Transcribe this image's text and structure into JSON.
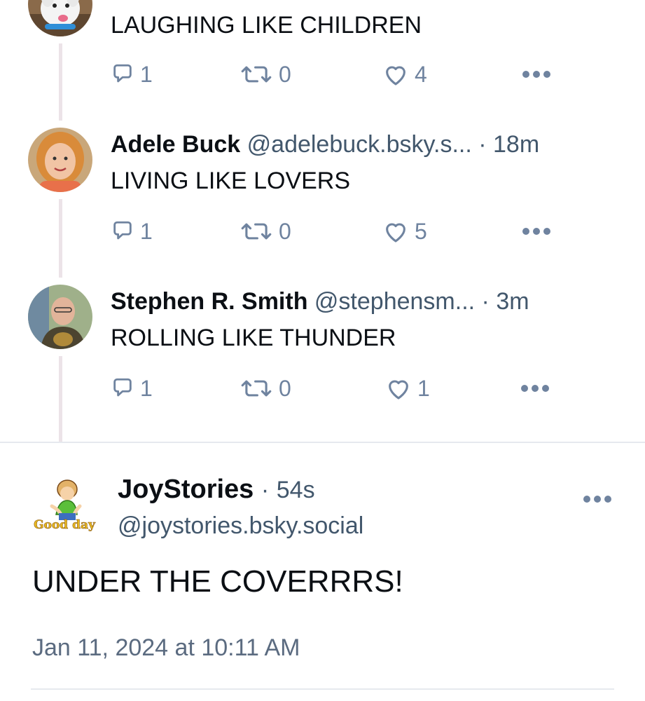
{
  "thread": {
    "posts": [
      {
        "text": "LAUGHING LIKE CHILDREN",
        "replies": "1",
        "reposts": "0",
        "likes": "4",
        "avatar_icon": "dog-avatar"
      },
      {
        "name": "Adele Buck",
        "handle": "@adelebuck.bsky.s...",
        "separator": "·",
        "time": "18m",
        "text": "LIVING LIKE LOVERS",
        "replies": "1",
        "reposts": "0",
        "likes": "5",
        "avatar_icon": "person-avatar"
      },
      {
        "name": "Stephen R. Smith",
        "handle": "@stephensm...",
        "separator": "·",
        "time": "3m",
        "text": "ROLLING LIKE THUNDER",
        "replies": "1",
        "reposts": "0",
        "likes": "1",
        "avatar_icon": "person-avatar"
      }
    ]
  },
  "main_post": {
    "name": "JoyStories",
    "separator": "·",
    "time": "54s",
    "handle": "@joystories.bsky.social",
    "text": "UNDER THE COVERRRS!",
    "timestamp": "Jan 11, 2024 at 10:11 AM",
    "avatar_caption": "Good day",
    "avatar_icon": "cartoon-avatar"
  },
  "icons": {
    "reply": "reply-icon",
    "repost": "repost-icon",
    "like": "heart-icon",
    "more": "more-icon"
  },
  "colors": {
    "text": "#0b0f14",
    "secondary": "#42576c",
    "action": "#6f839f",
    "thread_line": "#ece3e8",
    "divider": "#e6e9ee"
  }
}
